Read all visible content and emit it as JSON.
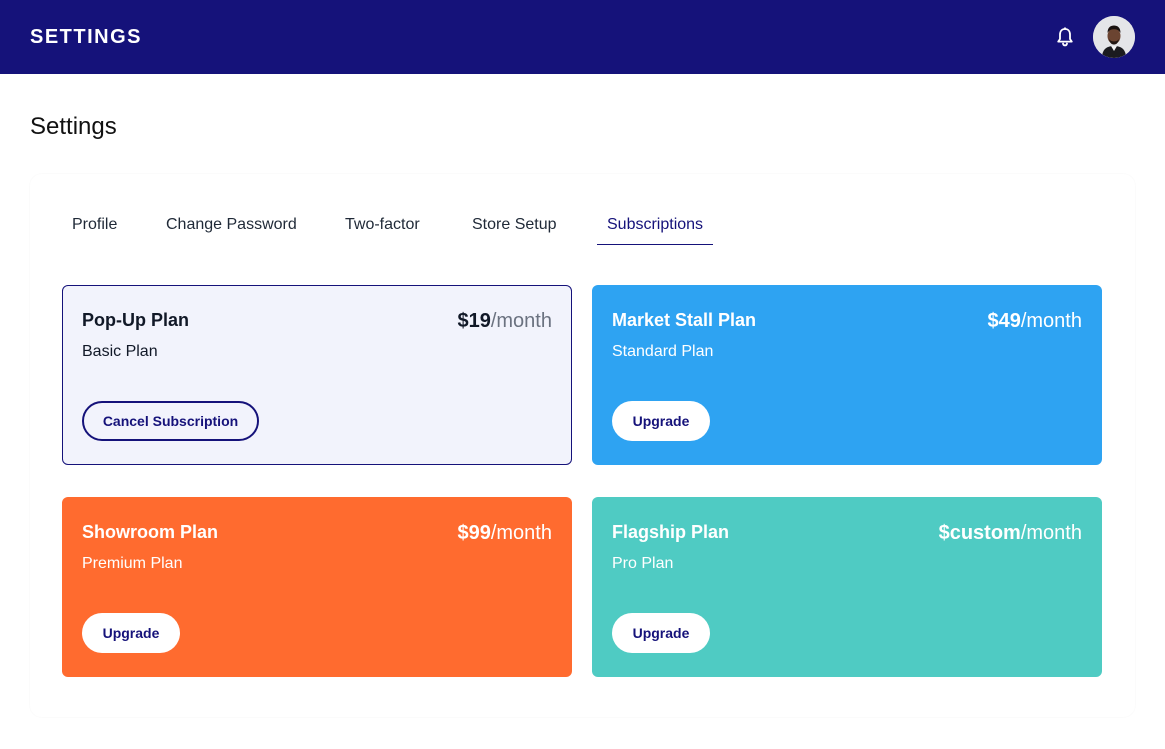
{
  "header": {
    "brand": "SETTINGS",
    "bell_icon": "bell-icon",
    "avatar_icon": "user-avatar"
  },
  "page": {
    "title": "Settings"
  },
  "tabs": [
    {
      "label": "Profile",
      "active": false
    },
    {
      "label": "Change Password",
      "active": false
    },
    {
      "label": "Two-factor",
      "active": false
    },
    {
      "label": "Store Setup",
      "active": false
    },
    {
      "label": "Subscriptions",
      "active": true
    }
  ],
  "plans": [
    {
      "name": "Pop-Up Plan",
      "tier": "Basic Plan",
      "amount": "$19",
      "per": "/month",
      "button": "Cancel Subscription",
      "color": "#f2f3fc",
      "current": true
    },
    {
      "name": "Market Stall Plan",
      "tier": "Standard Plan",
      "amount": "$49",
      "per": "/month",
      "button": "Upgrade",
      "color": "#2ea3f2",
      "current": false
    },
    {
      "name": "Showroom Plan",
      "tier": "Premium Plan",
      "amount": "$99",
      "per": "/month",
      "button": "Upgrade",
      "color": "#ff6b2f",
      "current": false
    },
    {
      "name": "Flagship Plan",
      "tier": "Pro Plan",
      "amount": "$custom",
      "per": "/month",
      "button": "Upgrade",
      "color": "#4fcbc3",
      "current": false
    }
  ],
  "colors": {
    "header_bg": "#15127a",
    "accent": "#15127a"
  }
}
